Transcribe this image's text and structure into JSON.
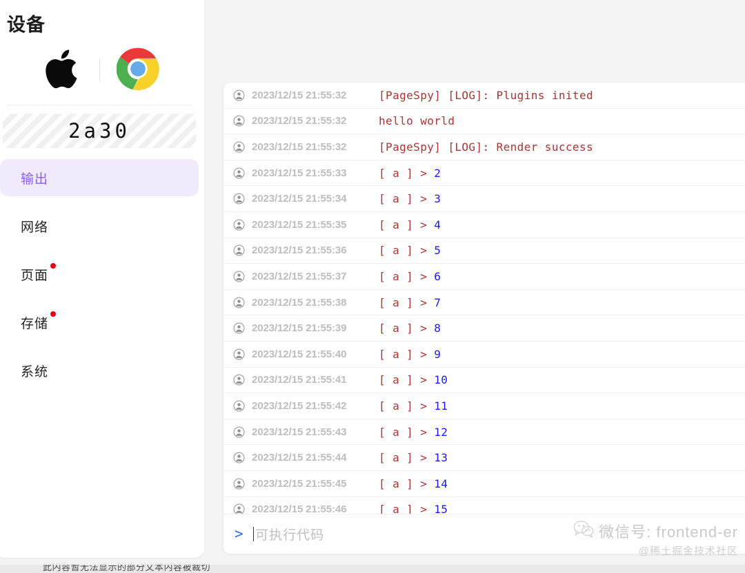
{
  "sidebar": {
    "title": "设备",
    "os_icon": "apple-logo-icon",
    "browser_icon": "chrome-logo-icon",
    "device_id": "2a30",
    "nav": [
      {
        "label": "输出",
        "active": true,
        "badge": false,
        "icon": "output-tab"
      },
      {
        "label": "网络",
        "active": false,
        "badge": false,
        "icon": "network-tab"
      },
      {
        "label": "页面",
        "active": false,
        "badge": true,
        "icon": "page-tab"
      },
      {
        "label": "存储",
        "active": false,
        "badge": true,
        "icon": "storage-tab"
      },
      {
        "label": "系统",
        "active": false,
        "badge": false,
        "icon": "system-tab"
      }
    ],
    "active_bg": "#f1eafd",
    "active_fg": "#8b5cf6",
    "badge_color": "#e60012"
  },
  "console": {
    "row_icon": "user-avatar-icon",
    "prompt_symbol": ">",
    "placeholder": "可执行代码",
    "input_value": "",
    "text_color": "#aa3333",
    "number_color": "#1a1ae6",
    "time_color": "#bdbdbd",
    "logs": [
      {
        "time": "2023/12/15 21:55:32",
        "message": "[PageSpy] [LOG]: Plugins inited",
        "number": ""
      },
      {
        "time": "2023/12/15 21:55:32",
        "message": "hello world",
        "number": ""
      },
      {
        "time": "2023/12/15 21:55:32",
        "message": "[PageSpy] [LOG]: Render success",
        "number": ""
      },
      {
        "time": "2023/12/15 21:55:33",
        "message": "[ a ] > ",
        "number": "2"
      },
      {
        "time": "2023/12/15 21:55:34",
        "message": "[ a ] > ",
        "number": "3"
      },
      {
        "time": "2023/12/15 21:55:35",
        "message": "[ a ] > ",
        "number": "4"
      },
      {
        "time": "2023/12/15 21:55:36",
        "message": "[ a ] > ",
        "number": "5"
      },
      {
        "time": "2023/12/15 21:55:37",
        "message": "[ a ] > ",
        "number": "6"
      },
      {
        "time": "2023/12/15 21:55:38",
        "message": "[ a ] > ",
        "number": "7"
      },
      {
        "time": "2023/12/15 21:55:39",
        "message": "[ a ] > ",
        "number": "8"
      },
      {
        "time": "2023/12/15 21:55:40",
        "message": "[ a ] > ",
        "number": "9"
      },
      {
        "time": "2023/12/15 21:55:41",
        "message": "[ a ] > ",
        "number": "10"
      },
      {
        "time": "2023/12/15 21:55:42",
        "message": "[ a ] > ",
        "number": "11"
      },
      {
        "time": "2023/12/15 21:55:43",
        "message": "[ a ] > ",
        "number": "12"
      },
      {
        "time": "2023/12/15 21:55:44",
        "message": "[ a ] > ",
        "number": "13"
      },
      {
        "time": "2023/12/15 21:55:45",
        "message": "[ a ] > ",
        "number": "14"
      },
      {
        "time": "2023/12/15 21:55:46",
        "message": "[ a ] > ",
        "number": "15"
      }
    ]
  },
  "watermark": {
    "icon": "wechat-icon",
    "line1": "微信号: frontend-er",
    "line2": "@稀土掘金技术社区"
  },
  "bottom_strip": {
    "text": "此内容暂无法显示的部分文本内容被裁切"
  }
}
